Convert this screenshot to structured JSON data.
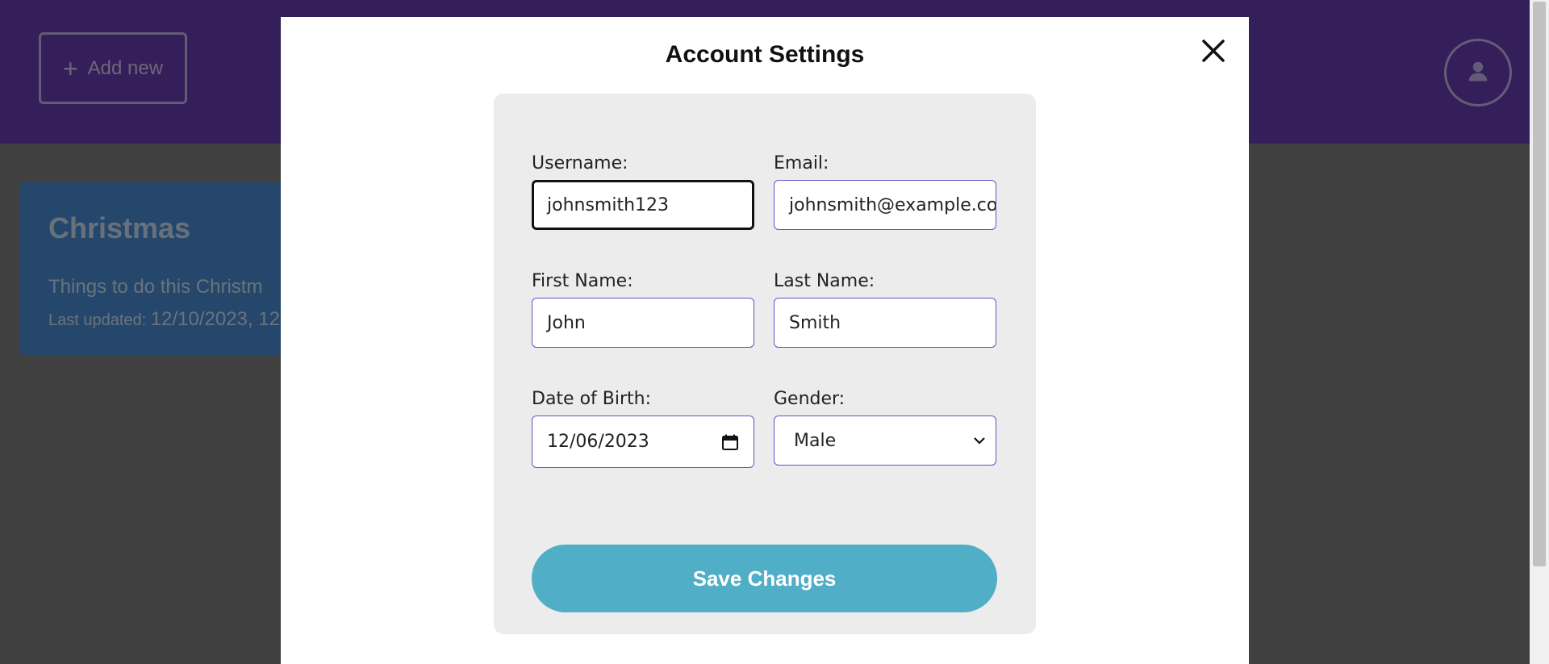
{
  "header": {
    "add_new_label": "Add new",
    "plus_icon": "+",
    "avatar_icon": "user-icon"
  },
  "card": {
    "title": "Christmas",
    "description": "Things to do this Christm",
    "updated_label": "Last updated:",
    "updated_value": "12/10/2023, 12"
  },
  "modal": {
    "title": "Account Settings",
    "close_icon": "close-icon",
    "fields": {
      "username": {
        "label": "Username:",
        "value": "johnsmith123"
      },
      "email": {
        "label": "Email:",
        "value": "johnsmith@example.co"
      },
      "first_name": {
        "label": "First Name:",
        "value": "John"
      },
      "last_name": {
        "label": "Last Name:",
        "value": "Smith"
      },
      "dob": {
        "label": "Date of Birth:",
        "value": "12/06/2023"
      },
      "gender": {
        "label": "Gender:",
        "value": "Male"
      }
    },
    "save_label": "Save Changes"
  },
  "colors": {
    "header_bg": "#6a3fb4",
    "card_bg": "#4a8fd9",
    "accent_border": "#6a4fc7",
    "save_button": "#50aec6",
    "panel_bg": "#ececec"
  }
}
